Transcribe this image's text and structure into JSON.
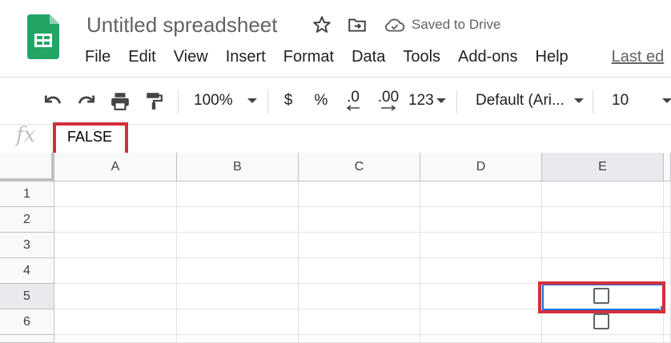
{
  "header": {
    "title": "Untitled spreadsheet",
    "saved_status": "Saved to Drive"
  },
  "menu": [
    "File",
    "Edit",
    "View",
    "Insert",
    "Format",
    "Data",
    "Tools",
    "Add-ons",
    "Help"
  ],
  "menu_last_edit": "Last ed",
  "toolbar": {
    "zoom": "100%",
    "currency": "$",
    "percent": "%",
    "dec_decrease": ".0",
    "dec_increase": ".00",
    "more_formats": "123",
    "font": "Default (Ari...",
    "font_size": "10"
  },
  "formula_bar": {
    "fx_label": "fx",
    "value": "FALSE"
  },
  "grid": {
    "columns": [
      "A",
      "B",
      "C",
      "D",
      "E"
    ],
    "rows": [
      "1",
      "2",
      "3",
      "4",
      "5",
      "6"
    ],
    "selected_cell": "E5",
    "checkboxes": [
      "E5",
      "E6"
    ]
  },
  "colors": {
    "sheets_green": "#23a566",
    "highlight_red": "#d32f3a",
    "selection_blue": "#1a73e8"
  }
}
